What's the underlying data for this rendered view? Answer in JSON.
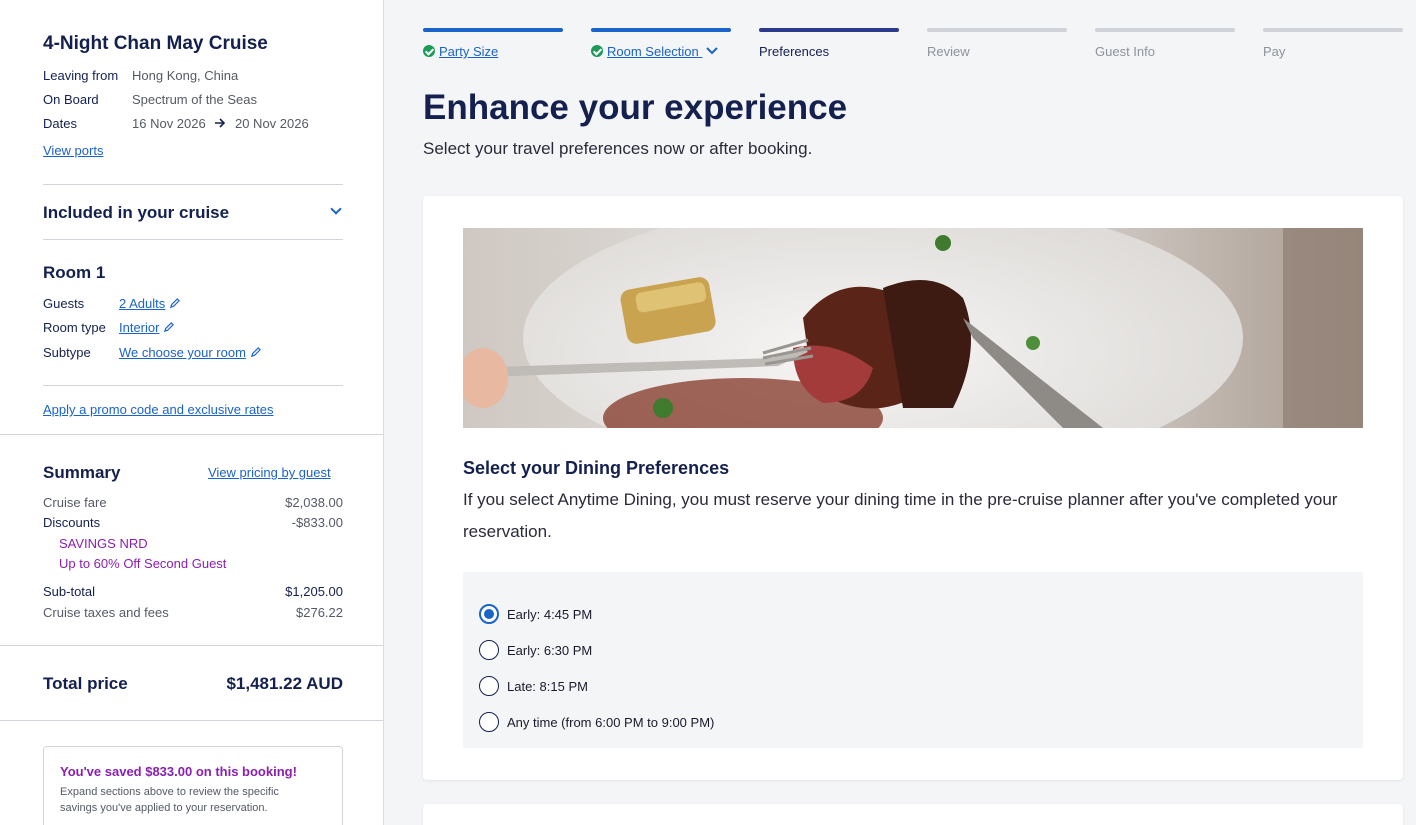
{
  "sidebar": {
    "cruise_title": "4-Night Chan May Cruise",
    "leaving_label": "Leaving from",
    "leaving_value": "Hong Kong, China",
    "onboard_label": "On Board",
    "onboard_value": "Spectrum of the Seas",
    "dates_label": "Dates",
    "date_start": "16 Nov 2026",
    "date_end": "20 Nov 2026",
    "view_ports": "View ports",
    "included_label": "Included in your cruise",
    "room_title": "Room 1",
    "guests_label": "Guests",
    "guests_value": "2 Adults",
    "room_type_label": "Room type",
    "room_type_value": "Interior",
    "subtype_label": "Subtype",
    "subtype_value": "We choose your room",
    "promo_link": "Apply a promo code and exclusive rates",
    "summary": {
      "title": "Summary",
      "view_pricing": "View pricing by guest",
      "cruise_fare_label": "Cruise fare",
      "cruise_fare_value": "$2,038.00",
      "discounts_label": "Discounts",
      "discounts_value": "-$833.00",
      "discount_1": "SAVINGS NRD",
      "discount_2": "Up to 60% Off Second Guest",
      "subtotal_label": "Sub-total",
      "subtotal_value": "$1,205.00",
      "taxes_label": "Cruise taxes and fees",
      "taxes_value": "$276.22"
    },
    "total_label": "Total price",
    "total_value": "$1,481.22 AUD",
    "saved_title": "You've saved $833.00 on this booking!",
    "saved_desc": "Expand sections above to review the specific savings you've applied to your reservation."
  },
  "stepper": {
    "steps": [
      {
        "label": "Party Size",
        "state": "done"
      },
      {
        "label": "Room Selection",
        "state": "done"
      },
      {
        "label": "Preferences",
        "state": "current"
      },
      {
        "label": "Review",
        "state": "future"
      },
      {
        "label": "Guest Info",
        "state": "future"
      },
      {
        "label": "Pay",
        "state": "future"
      }
    ]
  },
  "main": {
    "title": "Enhance your experience",
    "subtitle": "Select your travel preferences now or after booking.",
    "dining_title": "Select your Dining Preferences",
    "dining_desc": "If you select Anytime Dining, you must reserve your dining time in the pre-cruise planner after you've completed your reservation.",
    "options": [
      {
        "label": "Early: 4:45 PM",
        "selected": true
      },
      {
        "label": "Early: 6:30 PM",
        "selected": false
      },
      {
        "label": "Late: 8:15 PM",
        "selected": false
      },
      {
        "label": "Any time (from 6:00 PM to 9:00 PM)",
        "selected": false
      }
    ]
  },
  "colors": {
    "accent": "#1a63c8",
    "navy": "#14204e",
    "savings": "#8a1fb0",
    "success": "#1b9a59"
  }
}
